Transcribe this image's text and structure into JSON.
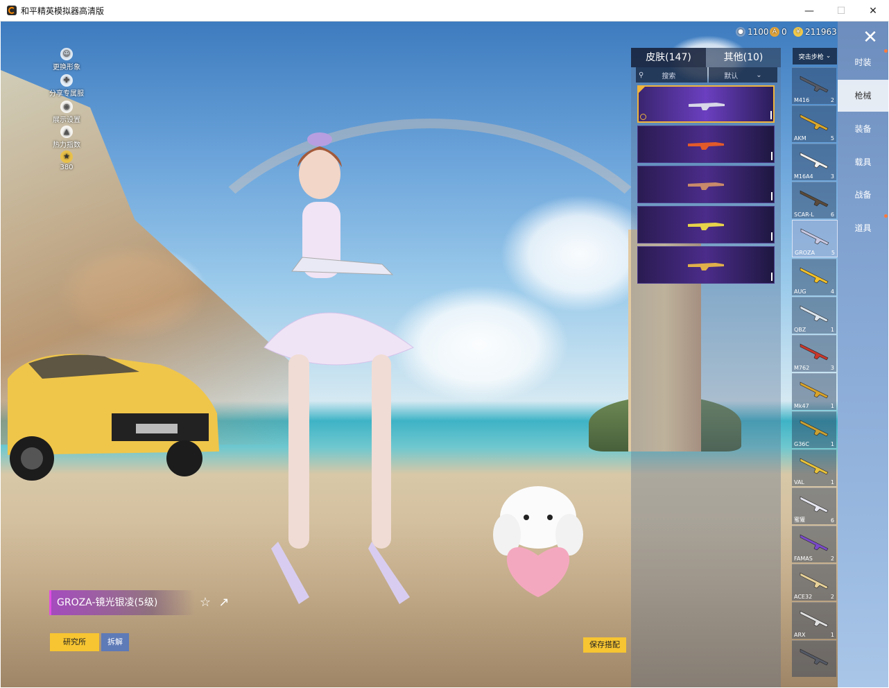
{
  "window": {
    "title": "和平精英模拟器高清版"
  },
  "left_menu": [
    {
      "label": "更换形象",
      "icon": "person-icon"
    },
    {
      "label": "分享专属服",
      "icon": "share-cross-icon"
    },
    {
      "label": "展示设置",
      "icon": "eye-icon"
    },
    {
      "label": "热力指数",
      "icon": "flame-icon"
    },
    {
      "label": "380",
      "icon": "rank-badge-icon"
    }
  ],
  "currency": [
    {
      "value": "1100",
      "icon": "token-icon",
      "color": "#7fa0c8"
    },
    {
      "value": "0",
      "icon": "coupon-icon",
      "color": "#e3a43a"
    },
    {
      "value": "211963",
      "icon": "coin-icon",
      "color": "#f0c84a"
    }
  ],
  "skin_panel": {
    "tabs": [
      {
        "label": "皮肤(147)"
      },
      {
        "label": "其他(10)"
      }
    ],
    "search_placeholder": "搜索",
    "sort_label": "默认",
    "skins": [
      {
        "gun_color": "#d8d8e8",
        "selected": true
      },
      {
        "gun_color": "#e25a2a",
        "selected": false
      },
      {
        "gun_color": "#c88a6a",
        "selected": false
      },
      {
        "gun_color": "#e8d44a",
        "selected": false
      },
      {
        "gun_color": "#e0b04a",
        "selected": false
      }
    ]
  },
  "gun_list": {
    "filter_label": "突击步枪",
    "items": [
      {
        "name": "M416",
        "level": "2",
        "color": "#555a66"
      },
      {
        "name": "AKM",
        "level": "5",
        "color": "#d9a72c"
      },
      {
        "name": "M16A4",
        "level": "3",
        "color": "#f0f0f0"
      },
      {
        "name": "SCAR-L",
        "level": "6",
        "color": "#5a4a3a"
      },
      {
        "name": "GROZA",
        "level": "5",
        "color": "#c9c9e3",
        "selected": true
      },
      {
        "name": "AUG",
        "level": "4",
        "color": "#f2c12a"
      },
      {
        "name": "QBZ",
        "level": "1",
        "color": "#dde6ee"
      },
      {
        "name": "M762",
        "level": "3",
        "color": "#c8362a"
      },
      {
        "name": "Mk47",
        "level": "1",
        "color": "#d8a32a"
      },
      {
        "name": "G36C",
        "level": "1",
        "color": "#c9a033"
      },
      {
        "name": "VAL",
        "level": "1",
        "color": "#e8c23a"
      },
      {
        "name": "蜜獾",
        "level": "6",
        "color": "#e6e6f0"
      },
      {
        "name": "FAMAS",
        "level": "2",
        "color": "#7a4ac8"
      },
      {
        "name": "ACE32",
        "level": "2",
        "color": "#e8d29a"
      },
      {
        "name": "ARX",
        "level": "1",
        "color": "#e0e0e0"
      },
      {
        "name": "",
        "level": "",
        "color": "#555a66"
      }
    ]
  },
  "categories": [
    {
      "label": "时装"
    },
    {
      "label": "枪械",
      "active": true
    },
    {
      "label": "装备"
    },
    {
      "label": "载具"
    },
    {
      "label": "战备"
    },
    {
      "label": "道具"
    }
  ],
  "weapon": {
    "name": "GROZA-镜光银凌(5级)"
  },
  "buttons": {
    "lab": "研究所",
    "dismantle": "拆解",
    "save": "保存搭配"
  }
}
